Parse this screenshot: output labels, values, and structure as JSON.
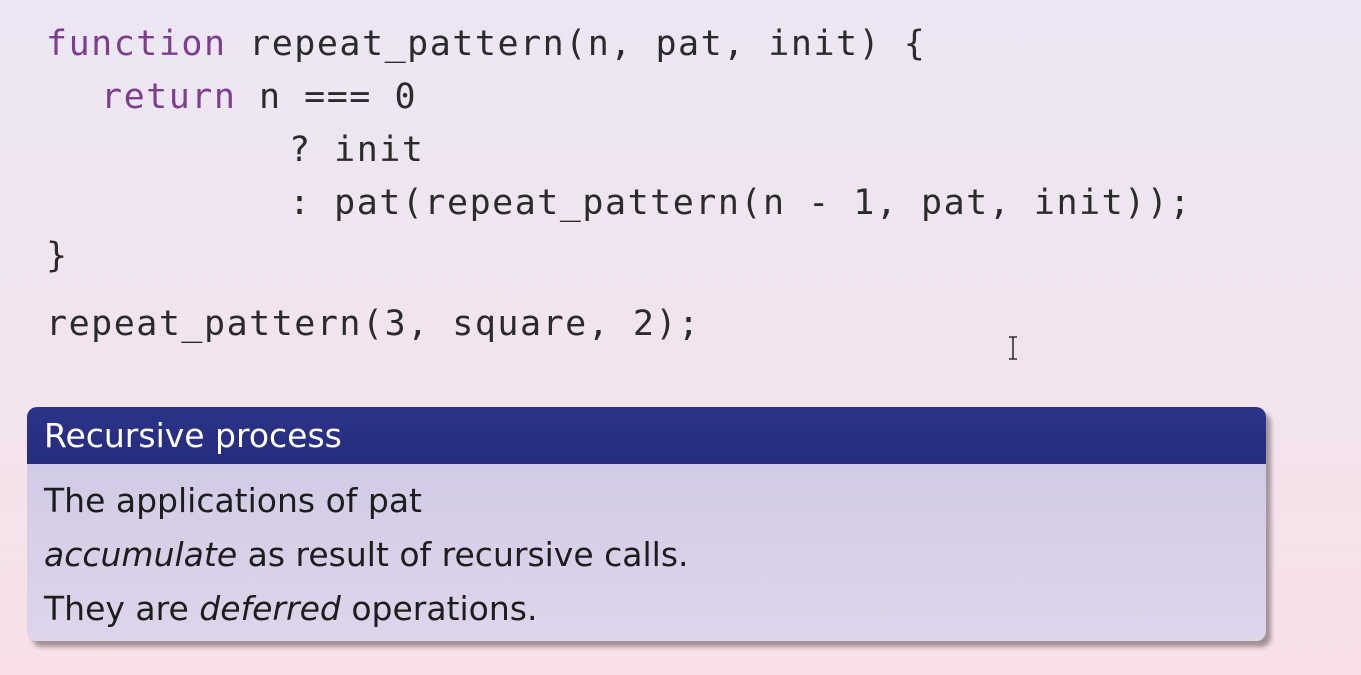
{
  "code": {
    "lines": [
      {
        "kw": "function",
        "rest": " repeat_pattern(n, pat, init) {"
      },
      {
        "kw": "return",
        "rest": " n === 0"
      },
      {
        "text": "? init"
      },
      {
        "text": ": pat(repeat_pattern(n - 1, pat, init));"
      },
      {
        "text": "}"
      }
    ],
    "call": "repeat_pattern(3, square, 2);"
  },
  "block": {
    "title": "Recursive process",
    "line1": "The applications of pat",
    "line2_em": "accumulate",
    "line2_rest": " as result of recursive calls.",
    "line3_pre": "They are ",
    "line3_em": "deferred",
    "line3_post": " operations."
  },
  "colors": {
    "keyword": "#7d3f8c",
    "block_title_bg": "#2c3488",
    "block_body_bg": "#d6cfe7"
  },
  "icons": {
    "cursor": "text-ibeam-cursor"
  }
}
